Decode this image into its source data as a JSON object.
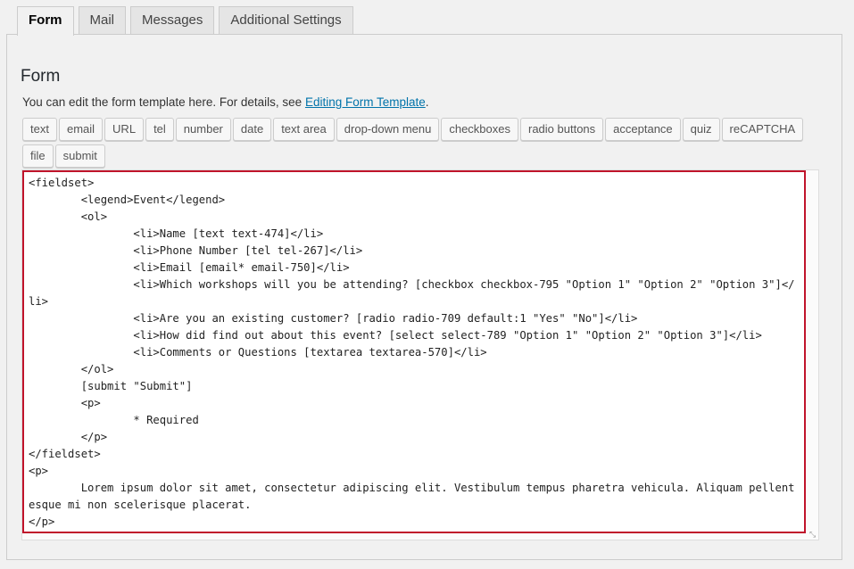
{
  "tabs": [
    {
      "label": "Form",
      "active": true
    },
    {
      "label": "Mail",
      "active": false
    },
    {
      "label": "Messages",
      "active": false
    },
    {
      "label": "Additional Settings",
      "active": false
    }
  ],
  "panel": {
    "title": "Form",
    "description_prefix": "You can edit the form template here. For details, see ",
    "description_link": "Editing Form Template",
    "description_suffix": "."
  },
  "tag_buttons": [
    "text",
    "email",
    "URL",
    "tel",
    "number",
    "date",
    "text area",
    "drop-down menu",
    "checkboxes",
    "radio buttons",
    "acceptance",
    "quiz",
    "reCAPTCHA",
    "file",
    "submit"
  ],
  "editor": {
    "content": "<fieldset>\n\t<legend>Event</legend>\n\t<ol>\n\t\t<li>Name [text text-474]</li>\n\t\t<li>Phone Number [tel tel-267]</li>\n\t\t<li>Email [email* email-750]</li>\n\t\t<li>Which workshops will you be attending? [checkbox checkbox-795 \"Option 1\" \"Option 2\" \"Option 3\"]</li>\n\t\t<li>Are you an existing customer? [radio radio-709 default:1 \"Yes\" \"No\"]</li>\n\t\t<li>How did find out about this event? [select select-789 \"Option 1\" \"Option 2\" \"Option 3\"]</li>\n\t\t<li>Comments or Questions [textarea textarea-570]</li>\n\t</ol>\n\t[submit \"Submit\"]\n\t<p>\n\t\t* Required\n\t</p>\n</fieldset>\n<p>\n\tLorem ipsum dolor sit amet, consectetur adipiscing elit. Vestibulum tempus pharetra vehicula. Aliquam pellentesque mi non scelerisque placerat.\n</p>"
  },
  "colors": {
    "highlight_border": "#c0142b",
    "link": "#0073aa"
  },
  "icons": {
    "resize": "resize-grip-icon"
  }
}
